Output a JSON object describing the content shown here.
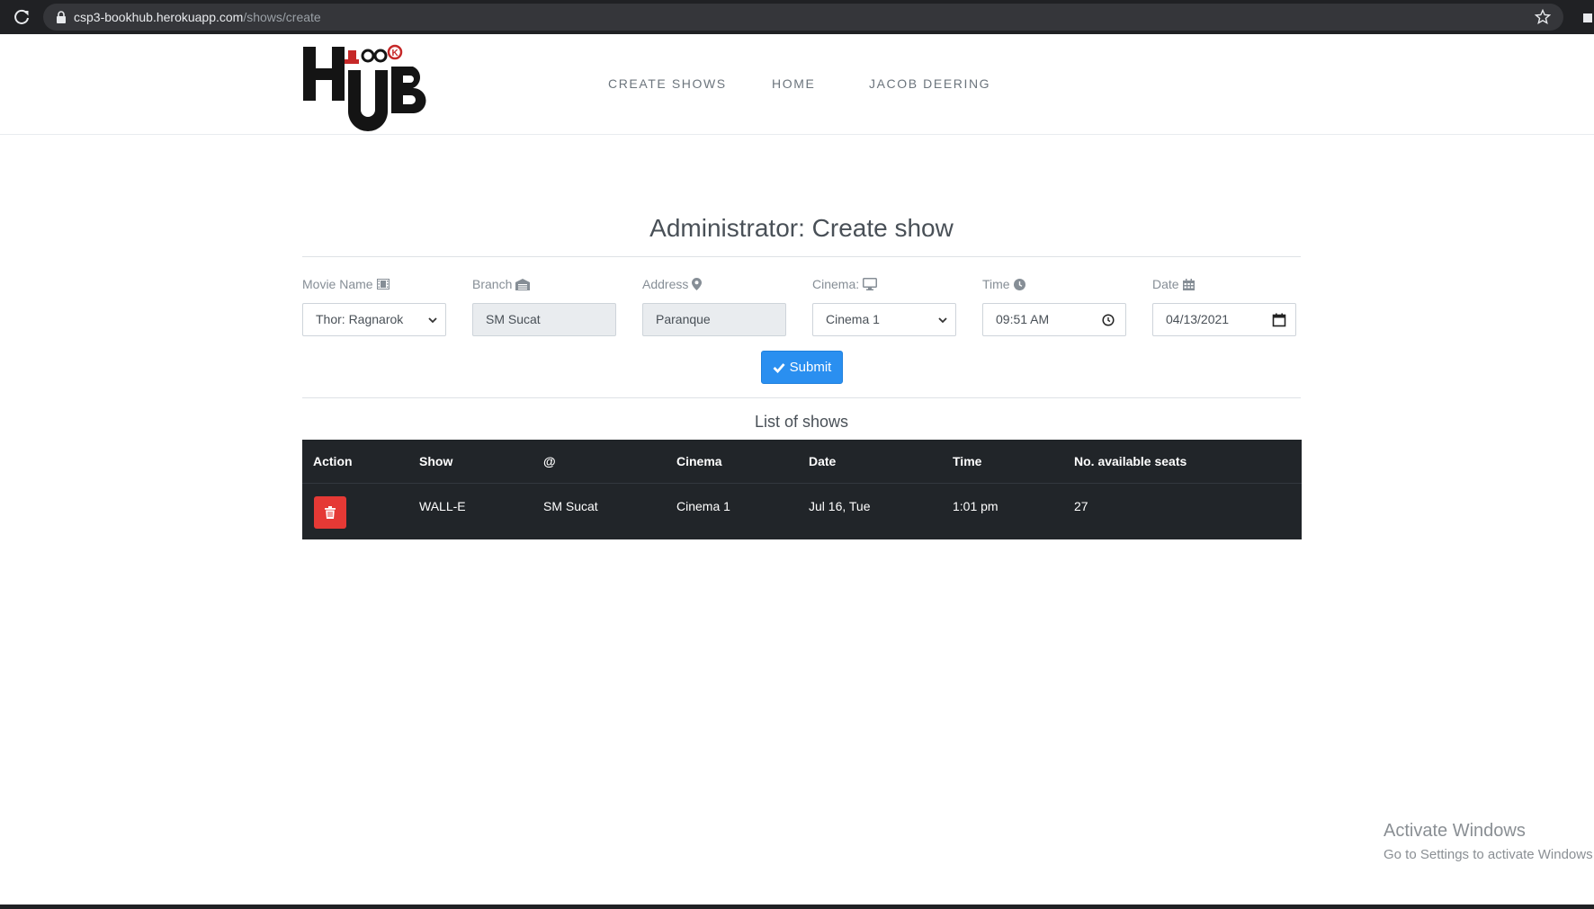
{
  "browser": {
    "url_host": "csp3-bookhub.herokuapp.com",
    "url_path": "/shows/create"
  },
  "nav": {
    "logo_text": "BOOK HUB",
    "links": [
      "CREATE SHOWS",
      "HOME",
      "JACOB DEERING"
    ]
  },
  "page": {
    "title": "Administrator: Create show"
  },
  "form": {
    "movie_label": "Movie Name",
    "movie_value": "Thor: Ragnarok",
    "branch_label": "Branch",
    "branch_value": "SM Sucat",
    "address_label": "Address",
    "address_value": "Paranque",
    "cinema_label": "Cinema:",
    "cinema_value": "Cinema 1",
    "time_label": "Time",
    "time_value": "09:51  AM",
    "date_label": "Date",
    "date_value": "04/13/2021",
    "submit_label": "Submit"
  },
  "shows": {
    "title": "List of shows",
    "columns": [
      "Action",
      "Show",
      "@",
      "Cinema",
      "Date",
      "Time",
      "No. available seats"
    ],
    "rows": [
      {
        "show": "WALL-E",
        "at": "SM Sucat",
        "cinema": "Cinema 1",
        "date": "Jul 16, Tue",
        "time": "1:01 pm",
        "seats": "27"
      }
    ]
  },
  "watermark": {
    "line1": "Activate Windows",
    "line2": "Go to Settings to activate Windows."
  },
  "colors": {
    "primary": "#2a8ff0",
    "danger": "#e53935",
    "table_bg": "#212529"
  },
  "icons": [
    "reload-icon",
    "lock-icon",
    "star-icon",
    "film-icon",
    "building-icon",
    "map-marker-icon",
    "desktop-icon",
    "clock-icon",
    "calendar-icon",
    "check-icon",
    "trash-icon",
    "chevron-down-icon"
  ]
}
